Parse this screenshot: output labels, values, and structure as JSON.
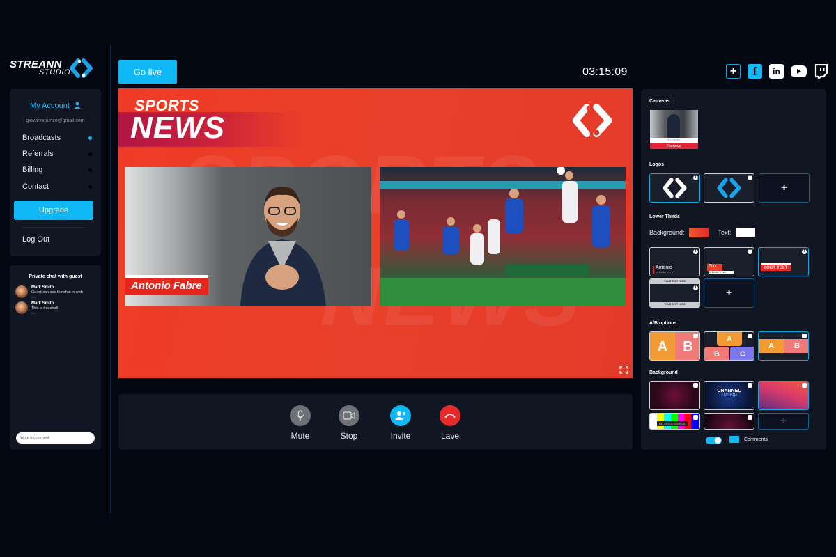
{
  "brand": {
    "name": "STREANN",
    "sub": "STUDIO"
  },
  "account": {
    "title": "My Account",
    "email": "giovannipunzo@gmail.com",
    "nav": [
      {
        "label": "Broadcasts",
        "active": true
      },
      {
        "label": "Referrals",
        "active": false
      },
      {
        "label": "Billing",
        "active": false
      },
      {
        "label": "Contact",
        "active": false
      }
    ],
    "upgrade_label": "Upgrade",
    "logout_label": "Log Out"
  },
  "chat": {
    "title": "Private chat with guest",
    "messages": [
      {
        "name": "Mark Smith",
        "text": "Guest can see the chat in web",
        "time": "1 m"
      },
      {
        "name": "Mark Smith",
        "text": "This is the chat!",
        "time": "2 m"
      }
    ],
    "input_placeholder": "Write a comment"
  },
  "topbar": {
    "go_live_label": "Go live",
    "timer": "03:15:09",
    "socials": [
      "add-destination",
      "facebook",
      "linkedin",
      "youtube",
      "twitch"
    ]
  },
  "stage": {
    "title_small": "SPORTS",
    "title_big": "NEWS",
    "watermark_1": "SPORTS",
    "watermark_2": "NEWS",
    "lower_third_name": "Antonio Fabre",
    "accent_color": "#e8402a"
  },
  "controls": [
    {
      "label": "Mute",
      "icon": "microphone-icon"
    },
    {
      "label": "Stop",
      "icon": "video-camera-icon"
    },
    {
      "label": "Invite",
      "icon": "add-user-icon"
    },
    {
      "label": "Lave",
      "icon": "hang-up-icon"
    }
  ],
  "right": {
    "cameras_title": "Cameras",
    "camera": {
      "label": "Rchd395",
      "remove_label": "Remove"
    },
    "logos_title": "Logos",
    "lower_thirds_title": "Lower Thirds",
    "background_label": "Background:",
    "text_label": "Text:",
    "lower_third_colors": {
      "background": "#e8402a",
      "text": "#ffffff"
    },
    "lower_third_templates": [
      {
        "name": "Antonio",
        "sub": "Co-founder & CTO"
      },
      {
        "name": "Gio",
        "sub": "Co-founder & CEO"
      },
      {
        "name": "YOUR TEXT"
      },
      {
        "top": "YOUR TEXT HERE",
        "bottom": "YOUR TEXT HERE"
      }
    ],
    "ab_title": "A/B options",
    "ab_letters": [
      "A",
      "B",
      "C"
    ],
    "background_title": "Background",
    "bg_channel_title": "CHANNEL",
    "bg_channel_sub": "TUNING",
    "bg_novideo": "NO VIDEO SOURCE",
    "comments_label": "Comments",
    "comments_enabled": true
  },
  "add_symbol": "+"
}
